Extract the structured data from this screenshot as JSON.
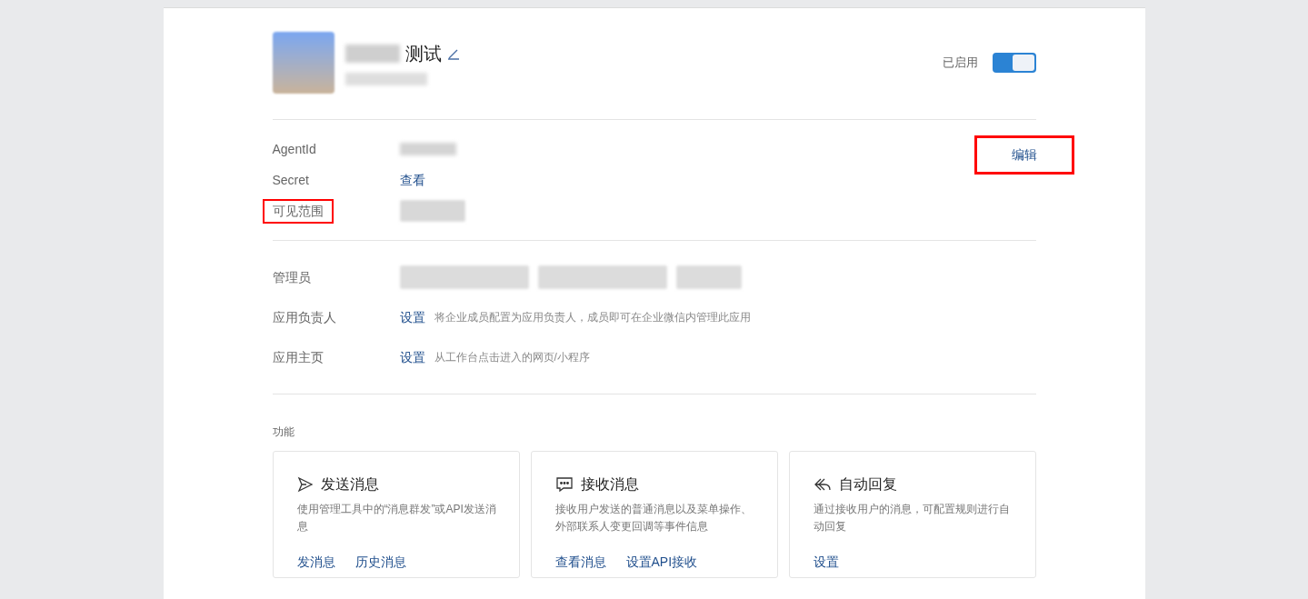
{
  "app": {
    "name": "测试",
    "enabled_label": "已启用",
    "enabled": true
  },
  "edit_button": {
    "label": "编辑",
    "highlighted": true
  },
  "info_rows": [
    {
      "label": "AgentId",
      "kind": "redacted",
      "highlighted": false
    },
    {
      "label": "Secret",
      "kind": "link",
      "value": "查看",
      "highlighted": false
    },
    {
      "label": "可见范围",
      "kind": "chip",
      "highlighted": true
    }
  ],
  "people_rows": [
    {
      "label": "管理员",
      "kind": "chips"
    },
    {
      "label": "应用负责人",
      "kind": "setting",
      "link": "设置",
      "hint": "将企业成员配置为应用负责人，成员即可在企业微信内管理此应用"
    },
    {
      "label": "应用主页",
      "kind": "setting",
      "link": "设置",
      "hint": "从工作台点击进入的网页/小程序"
    }
  ],
  "features": {
    "title": "功能",
    "cards": [
      {
        "kind": "send",
        "title": "发送消息",
        "description": "使用管理工具中的“消息群发”或API发送消息",
        "links": [
          "发消息",
          "历史消息"
        ]
      },
      {
        "kind": "chat",
        "title": "接收消息",
        "description": "接收用户发送的普通消息以及菜单操作、外部联系人变更回调等事件信息",
        "links": [
          "查看消息",
          "设置API接收"
        ]
      },
      {
        "kind": "reply",
        "title": "自动回复",
        "description": "通过接收用户的消息，可配置规则进行自动回复",
        "links": [
          "设置"
        ]
      }
    ]
  }
}
